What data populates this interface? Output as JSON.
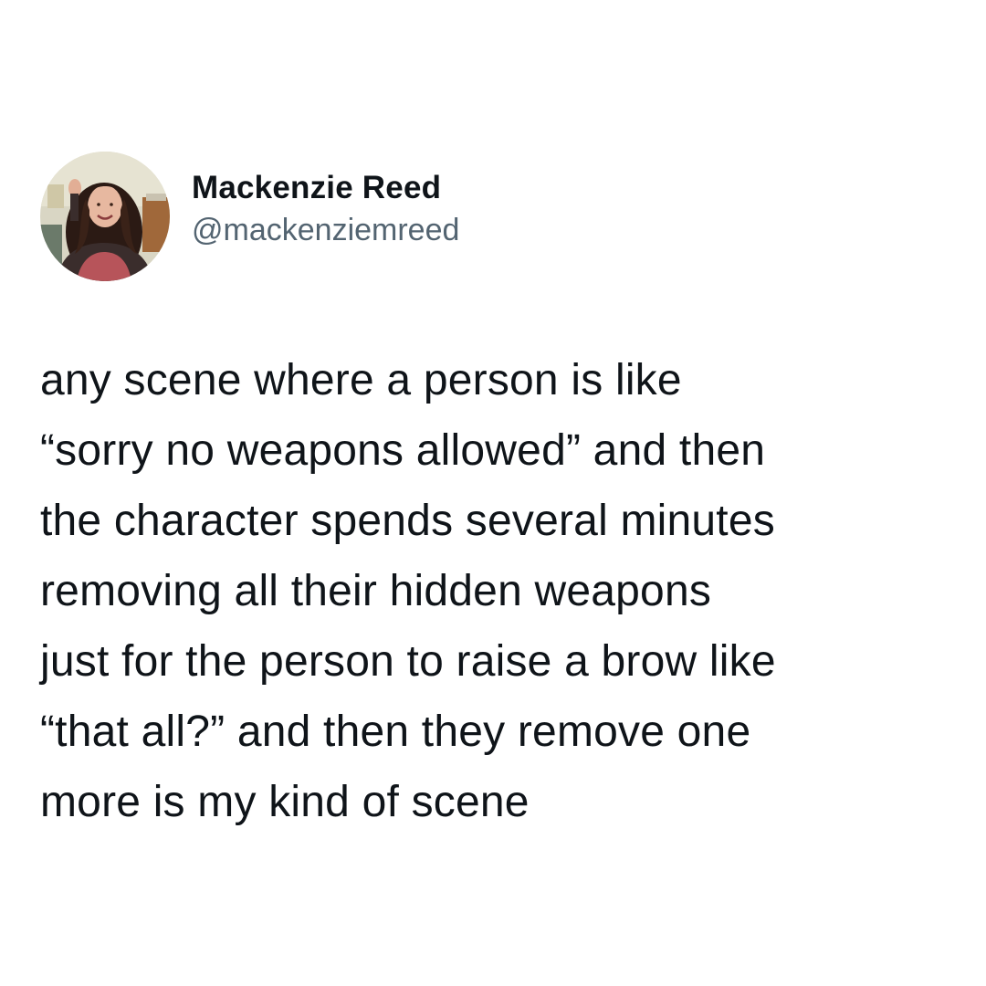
{
  "tweet": {
    "author": {
      "display_name": "Mackenzie Reed",
      "handle": "@mackenziemreed",
      "avatar_icon": "profile-photo"
    },
    "text": "any scene where a person is like\n“sorry no weapons allowed” and then\nthe character spends several minutes\nremoving all their hidden weapons\njust for the person to raise a brow like\n“that all?” and then they remove one\nmore is my kind of scene"
  },
  "colors": {
    "background": "#ffffff",
    "text_primary": "#0f1419",
    "text_secondary": "#536471"
  }
}
